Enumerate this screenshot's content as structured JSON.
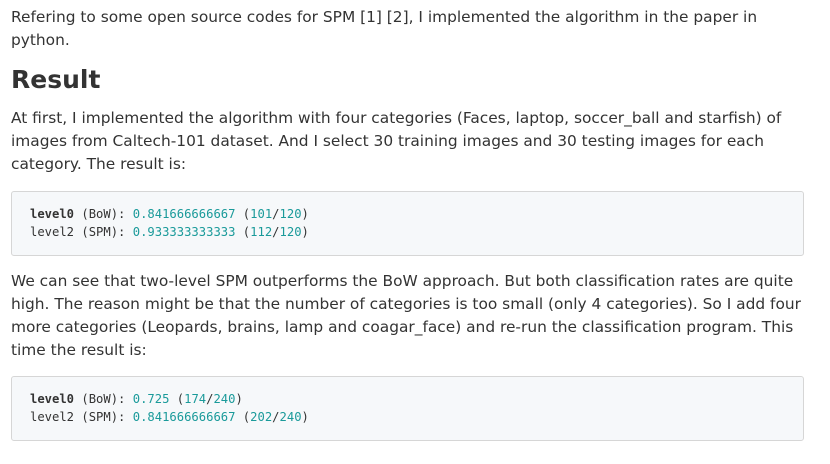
{
  "paragraphs": {
    "intro": "Refering to some open source codes for SPM [1] [2], I implemented the algorithm in the paper in python.",
    "first_experiment": "At first, I implemented the algorithm with four categories (Faces, laptop, soccer_ball and starfish) of images from Caltech-101 dataset. And I select 30 training images and 30 testing images for each category. The result is:",
    "second_experiment": "We can see that two-level SPM outperforms the BoW approach. But both classification rates are quite high. The reason might be that the number of categories is too small (only 4 categories). So I add four more categories (Leopards, brains, lamp and coagar_face) and re-run the classification program. This time the result is:"
  },
  "heading": "Result",
  "code_blocks": [
    {
      "lines": [
        {
          "name": "level0",
          "label": " (BoW): ",
          "rate": "0.841666666667",
          "open": " (",
          "correct": "101",
          "slash": "/",
          "total": "120",
          "close": ")"
        },
        {
          "name": "level2",
          "label": " (SPM): ",
          "rate": "0.933333333333",
          "open": " (",
          "correct": "112",
          "slash": "/",
          "total": "120",
          "close": ")"
        }
      ]
    },
    {
      "lines": [
        {
          "name": "level0",
          "label": " (BoW): ",
          "rate": "0.725",
          "open": " (",
          "correct": "174",
          "slash": "/",
          "total": "240",
          "close": ")"
        },
        {
          "name": "level2",
          "label": " (SPM): ",
          "rate": "0.841666666667",
          "open": " (",
          "correct": "202",
          "slash": "/",
          "total": "240",
          "close": ")"
        }
      ]
    }
  ],
  "colors": {
    "text": "#333333",
    "code_background": "#f6f8fa",
    "code_border": "#d6d6d6",
    "number": "#1a9a9a"
  }
}
